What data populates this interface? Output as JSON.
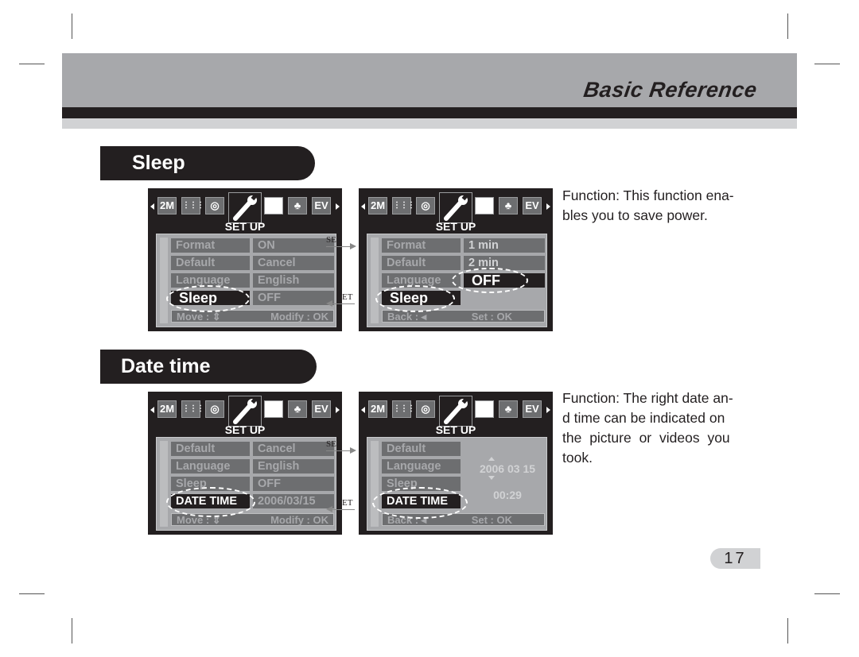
{
  "header": {
    "title": "Basic Reference"
  },
  "sections": [
    {
      "title": "Sleep",
      "description": "Function: This function ena-bles you to save power.",
      "description_lines": [
        "Function: This function ena-",
        "bles you to save power."
      ],
      "screens": [
        {
          "title": "SET UP",
          "rows": [
            {
              "label": "Format",
              "value": "ON"
            },
            {
              "label": "Default",
              "value": "Cancel"
            },
            {
              "label": "Language",
              "value": "English"
            },
            {
              "label": "Sleep",
              "value": "OFF",
              "selected": true
            }
          ],
          "footer_left": "Move : ⇕",
          "footer_right": "Modify : OK"
        },
        {
          "title": "SET UP",
          "rows": [
            {
              "label": "Format",
              "value": "1 min"
            },
            {
              "label": "Default",
              "value": "2 min"
            },
            {
              "label": "Language",
              "value": "OFF",
              "selected_value": true
            },
            {
              "label": "Sleep",
              "selected": true
            }
          ],
          "footer_left": "Back : ◂",
          "footer_right": "Set : OK"
        }
      ]
    },
    {
      "title": "Date time",
      "description_lines": [
        "Function: The right date an-",
        "d time can be indicated on",
        "the picture or videos you",
        "took."
      ],
      "screens": [
        {
          "title": "SET UP",
          "rows": [
            {
              "label": "Default",
              "value": "Cancel"
            },
            {
              "label": "Language",
              "value": "English"
            },
            {
              "label": "Sleep",
              "value": "OFF"
            },
            {
              "label": "DATE TIME",
              "value": "2006/03/15",
              "selected": true
            }
          ],
          "footer_left": "Move : ⇕",
          "footer_right": "Modify : OK"
        },
        {
          "title": "SET UP",
          "rows": [
            {
              "label": "Default"
            },
            {
              "label": "Language"
            },
            {
              "label": "Sleep"
            },
            {
              "label": "DATE TIME",
              "selected": true
            }
          ],
          "date_value": "2006 03 15",
          "time_value": "00:29",
          "footer_left": "Back : ◂",
          "footer_right": "Set : OK"
        }
      ]
    }
  ],
  "iconbar": {
    "resolution": "2M",
    "ev": "EV"
  },
  "flow": {
    "set_top": "SET",
    "set_bottom": "ET"
  },
  "page_number": "17"
}
